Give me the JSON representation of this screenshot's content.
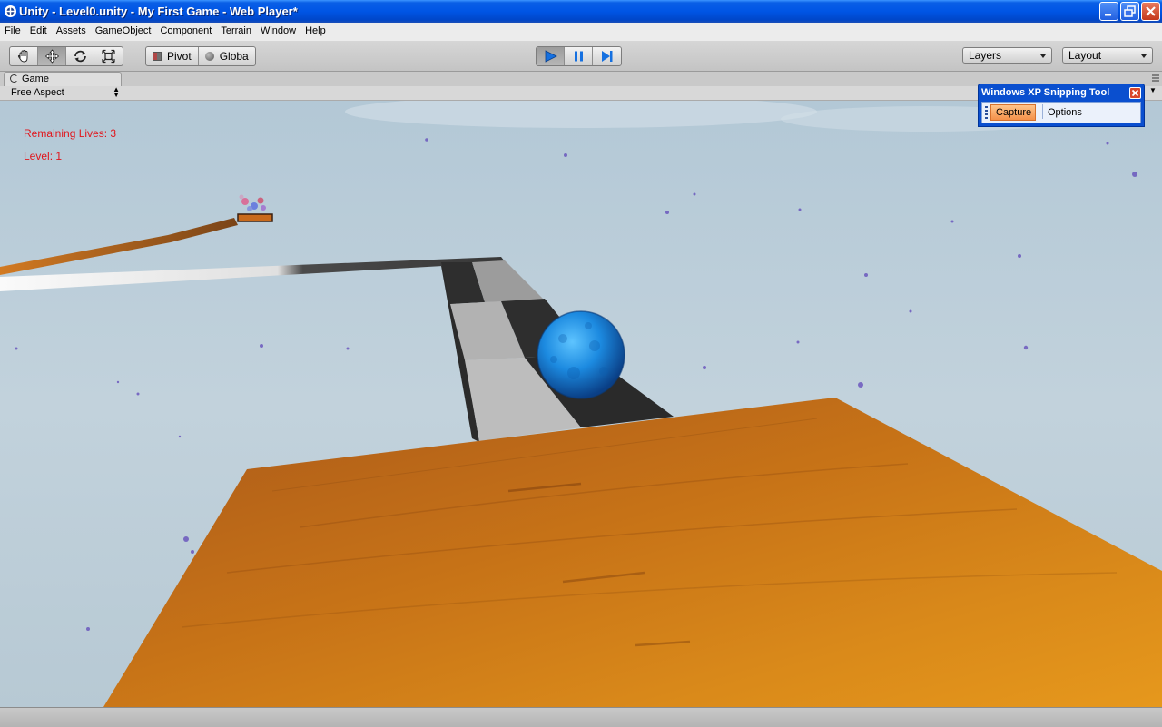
{
  "window": {
    "title": "Unity - Level0.unity - My First Game - Web Player*"
  },
  "menu": [
    "File",
    "Edit",
    "Assets",
    "GameObject",
    "Component",
    "Terrain",
    "Window",
    "Help"
  ],
  "toolbar": {
    "transform_tools": [
      "hand-tool",
      "move-tool",
      "rotate-tool",
      "scale-tool"
    ],
    "active_tool": "move-tool",
    "pivot_label": "Pivot",
    "global_label": "Globa",
    "layers_label": "Layers",
    "layout_label": "Layout"
  },
  "game_view": {
    "tab_label": "Game",
    "aspect_label": "Free Aspect",
    "hud": {
      "lives_text": "Remaining Lives: 3",
      "level_text": "Level: 1"
    }
  },
  "snipping_tool": {
    "title": "Windows XP Snipping Tool",
    "capture_label": "Capture",
    "options_label": "Options"
  },
  "colors": {
    "titlebar_blue": "#0055e5",
    "hud_red": "#e1151b",
    "ball_blue": "#1f8be0",
    "wood": "#c8781a",
    "sky": "#b9ccd8"
  }
}
